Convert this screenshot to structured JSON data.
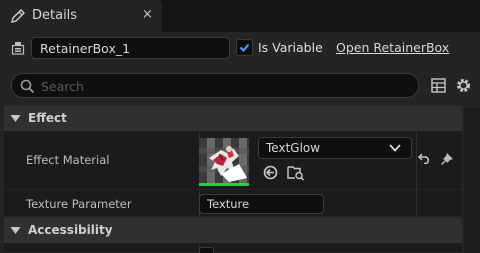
{
  "tab": {
    "title": "Details",
    "close_glyph": "×",
    "icon": "pencil-icon"
  },
  "header": {
    "name_value": "RetainerBox_1",
    "is_variable_label": "Is Variable",
    "is_variable_checked": true,
    "open_link": "Open RetainerBox"
  },
  "search": {
    "placeholder": "Search"
  },
  "sections": {
    "effect": {
      "title": "Effect",
      "effect_material_label": "Effect Material",
      "effect_material_value": "TextGlow",
      "texture_parameter_label": "Texture Parameter",
      "texture_parameter_value": "Texture"
    },
    "accessibility": {
      "title": "Accessibility"
    }
  },
  "colors": {
    "accent": "#2ecc40",
    "checkbox_check": "#4aa3ff",
    "panel_bg": "#242424"
  }
}
